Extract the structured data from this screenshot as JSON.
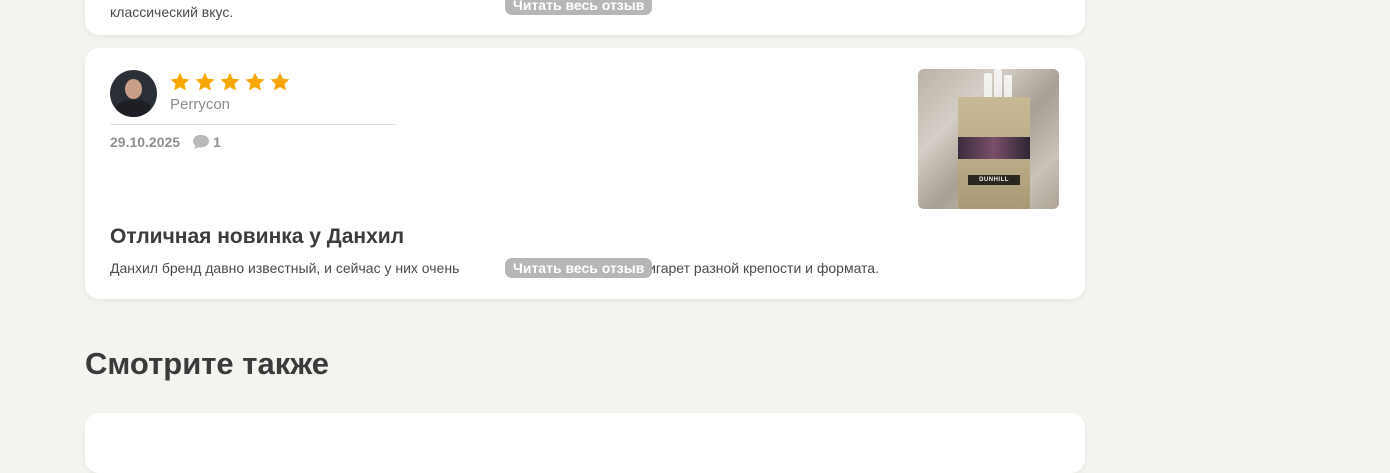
{
  "prev_review": {
    "text_tail": "классический вкус.",
    "read_more_label": "Читать весь отзыв"
  },
  "review": {
    "username": "Perrycon",
    "rating": 5,
    "rating_max": 5,
    "date": "29.10.2025",
    "comments_count": "1",
    "title": "Отличная новинка у Данхил",
    "excerpt_start": "Данхил бренд давно известный, и сейчас у них очень",
    "excerpt_end": "й сигарет разной крепости и формата.",
    "read_more_label": "Читать весь отзыв",
    "photo_brand_text": "DUNHILL"
  },
  "see_also": {
    "heading": "Смотрите также"
  },
  "colors": {
    "star": "#f6a800",
    "pill": "#b6b6b6",
    "background": "#f5f3ef"
  }
}
